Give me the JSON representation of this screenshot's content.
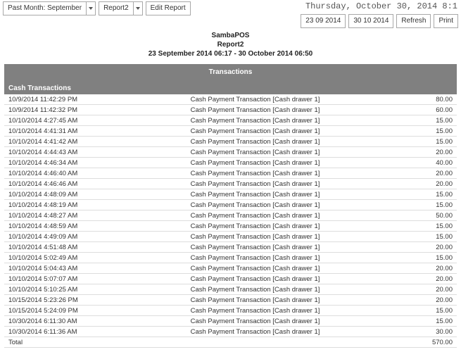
{
  "header": {
    "timestamp": "Thursday, October 30, 2014 8:1"
  },
  "toolbar_left": {
    "past_month_label": "Past Month: September",
    "report_label": "Report2",
    "edit_report_label": "Edit Report"
  },
  "toolbar_right": {
    "date1": "23 09 2014",
    "date2": "30 10 2014",
    "refresh": "Refresh",
    "print": "Print"
  },
  "report_header": {
    "app": "SambaPOS",
    "name": "Report2",
    "range": "23 September 2014 06:17 - 30 October 2014 06:50"
  },
  "section": {
    "title": "Transactions",
    "subtitle": "Cash Transactions"
  },
  "rows": [
    {
      "date": "10/9/2014 11:42:29 PM",
      "desc": "Cash Payment Transaction [Cash drawer 1]",
      "amt": "80.00"
    },
    {
      "date": "10/9/2014 11:42:32 PM",
      "desc": "Cash Payment Transaction [Cash drawer 1]",
      "amt": "60.00"
    },
    {
      "date": "10/10/2014 4:27:45 AM",
      "desc": "Cash Payment Transaction [Cash drawer 1]",
      "amt": "15.00"
    },
    {
      "date": "10/10/2014 4:41:31 AM",
      "desc": "Cash Payment Transaction [Cash drawer 1]",
      "amt": "15.00"
    },
    {
      "date": "10/10/2014 4:41:42 AM",
      "desc": "Cash Payment Transaction [Cash drawer 1]",
      "amt": "15.00"
    },
    {
      "date": "10/10/2014 4:44:43 AM",
      "desc": "Cash Payment Transaction [Cash drawer 1]",
      "amt": "20.00"
    },
    {
      "date": "10/10/2014 4:46:34 AM",
      "desc": "Cash Payment Transaction [Cash drawer 1]",
      "amt": "40.00"
    },
    {
      "date": "10/10/2014 4:46:40 AM",
      "desc": "Cash Payment Transaction [Cash drawer 1]",
      "amt": "20.00"
    },
    {
      "date": "10/10/2014 4:46:46 AM",
      "desc": "Cash Payment Transaction [Cash drawer 1]",
      "amt": "20.00"
    },
    {
      "date": "10/10/2014 4:48:09 AM",
      "desc": "Cash Payment Transaction [Cash drawer 1]",
      "amt": "15.00"
    },
    {
      "date": "10/10/2014 4:48:19 AM",
      "desc": "Cash Payment Transaction [Cash drawer 1]",
      "amt": "15.00"
    },
    {
      "date": "10/10/2014 4:48:27 AM",
      "desc": "Cash Payment Transaction [Cash drawer 1]",
      "amt": "50.00"
    },
    {
      "date": "10/10/2014 4:48:59 AM",
      "desc": "Cash Payment Transaction [Cash drawer 1]",
      "amt": "15.00"
    },
    {
      "date": "10/10/2014 4:49:09 AM",
      "desc": "Cash Payment Transaction [Cash drawer 1]",
      "amt": "15.00"
    },
    {
      "date": "10/10/2014 4:51:48 AM",
      "desc": "Cash Payment Transaction [Cash drawer 1]",
      "amt": "20.00"
    },
    {
      "date": "10/10/2014 5:02:49 AM",
      "desc": "Cash Payment Transaction [Cash drawer 1]",
      "amt": "15.00"
    },
    {
      "date": "10/10/2014 5:04:43 AM",
      "desc": "Cash Payment Transaction [Cash drawer 1]",
      "amt": "20.00"
    },
    {
      "date": "10/10/2014 5:07:07 AM",
      "desc": "Cash Payment Transaction [Cash drawer 1]",
      "amt": "20.00"
    },
    {
      "date": "10/10/2014 5:10:25 AM",
      "desc": "Cash Payment Transaction [Cash drawer 1]",
      "amt": "20.00"
    },
    {
      "date": "10/15/2014 5:23:26 PM",
      "desc": "Cash Payment Transaction [Cash drawer 1]",
      "amt": "20.00"
    },
    {
      "date": "10/15/2014 5:24:09 PM",
      "desc": "Cash Payment Transaction [Cash drawer 1]",
      "amt": "15.00"
    },
    {
      "date": "10/30/2014 6:11:30 AM",
      "desc": "Cash Payment Transaction [Cash drawer 1]",
      "amt": "15.00"
    },
    {
      "date": "10/30/2014 6:11:36 AM",
      "desc": "Cash Payment Transaction [Cash drawer 1]",
      "amt": "30.00"
    }
  ],
  "total": {
    "label": "Total",
    "amt": "570.00"
  }
}
